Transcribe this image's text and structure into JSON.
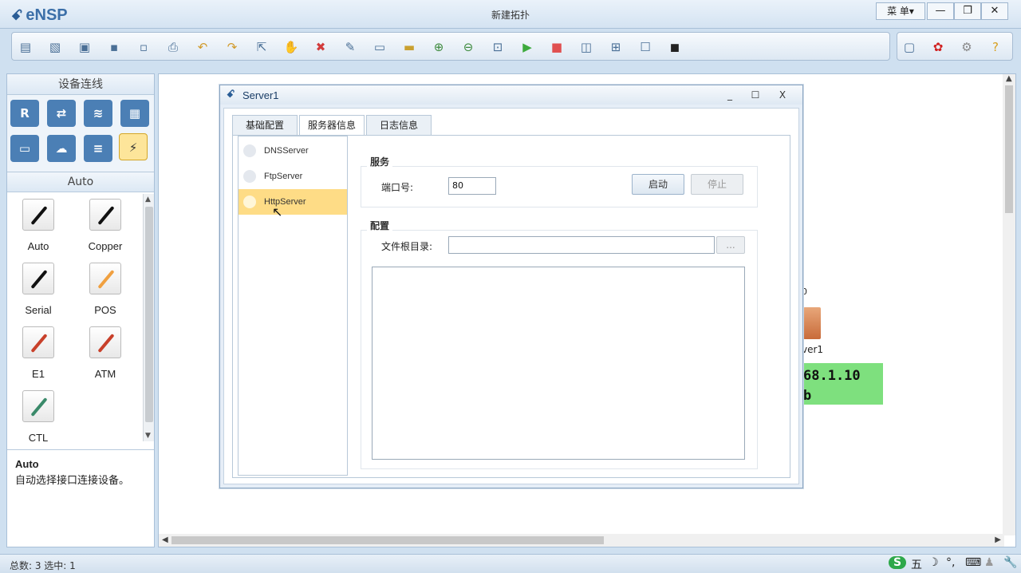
{
  "app": {
    "logo": "eNSP",
    "title": "新建拓扑",
    "menu_label": "菜 单▾",
    "min_glyph": "—",
    "restore_glyph": "❐",
    "close_glyph": "✕"
  },
  "toolbar": {
    "icons": [
      "new-topology-icon",
      "new-lab-icon",
      "open-icon",
      "save-icon",
      "save-as-icon",
      "print-icon",
      "undo-icon",
      "redo-icon",
      "select-icon",
      "pan-hand-icon",
      "delete-icon",
      "delete-link-icon",
      "add-note-icon",
      "add-shape-icon",
      "zoom-in-icon",
      "zoom-out-icon",
      "fit-view-icon",
      "start-device-icon",
      "stop-device-icon",
      "capture-data-icon",
      "topology-icon",
      "panel-icon",
      "command-line-icon"
    ],
    "right_icons": [
      "chat-icon",
      "huawei-logo-icon",
      "settings-gear-icon",
      "help-icon"
    ]
  },
  "left_panel": {
    "header": "设备连线",
    "sub_header": "Auto",
    "devices": [
      {
        "name": "router-icon",
        "glyph": "R",
        "color": "#4b7fb5"
      },
      {
        "name": "switch-icon",
        "glyph": "⇄",
        "color": "#4b7fb5"
      },
      {
        "name": "wireless-icon",
        "glyph": "≋",
        "color": "#4b7fb5"
      },
      {
        "name": "firewall-icon",
        "glyph": "▦",
        "color": "#4b7fb5"
      },
      {
        "name": "pc-icon",
        "glyph": "▭",
        "color": "#4b7fb5"
      },
      {
        "name": "cloud-icon",
        "glyph": "☁",
        "color": "#4b7fb5"
      },
      {
        "name": "server-rack-icon",
        "glyph": "≡",
        "color": "#4b7fb5"
      },
      {
        "name": "connection-icon",
        "glyph": "⚡",
        "color": "#fde59a"
      }
    ],
    "cables": [
      {
        "label": "Auto",
        "color": "#111111",
        "name": "auto-cable-icon"
      },
      {
        "label": "Copper",
        "color": "#111111",
        "name": "copper-cable-icon"
      },
      {
        "label": "Serial",
        "color": "#111111",
        "name": "serial-cable-icon"
      },
      {
        "label": "POS",
        "color": "#f0a040",
        "name": "pos-cable-icon"
      },
      {
        "label": "E1",
        "color": "#c8402a",
        "name": "e1-cable-icon"
      },
      {
        "label": "ATM",
        "color": "#c8402a",
        "name": "atm-cable-icon"
      },
      {
        "label": "CTL",
        "color": "#3a8a6a",
        "name": "ctl-cable-icon"
      }
    ],
    "desc_title": "Auto",
    "desc_text": "自动选择接口连接设备。"
  },
  "canvas": {
    "dot_label": "0",
    "server_name": "ver1",
    "ip_line1": "68.1.10",
    "ip_line2": "b"
  },
  "dialog": {
    "title": "Server1",
    "min": "_",
    "max": "☐",
    "close": "X",
    "tabs": [
      "基础配置",
      "服务器信息",
      "日志信息"
    ],
    "active_tab": 1,
    "services": [
      "DNSServer",
      "FtpServer",
      "HttpServer"
    ],
    "selected_service": 2,
    "service_group": "服务",
    "port_label": "端口号:",
    "port_value": "80",
    "start_label": "启动",
    "stop_label": "停止",
    "config_group": "配置",
    "root_label": "文件根目录:",
    "root_value": "",
    "browse_label": "..."
  },
  "status": {
    "text": "总数: 3  选中: 1",
    "ime": [
      "S",
      "五",
      "☽",
      "°,",
      "⌨",
      "♟",
      "🔧"
    ]
  }
}
